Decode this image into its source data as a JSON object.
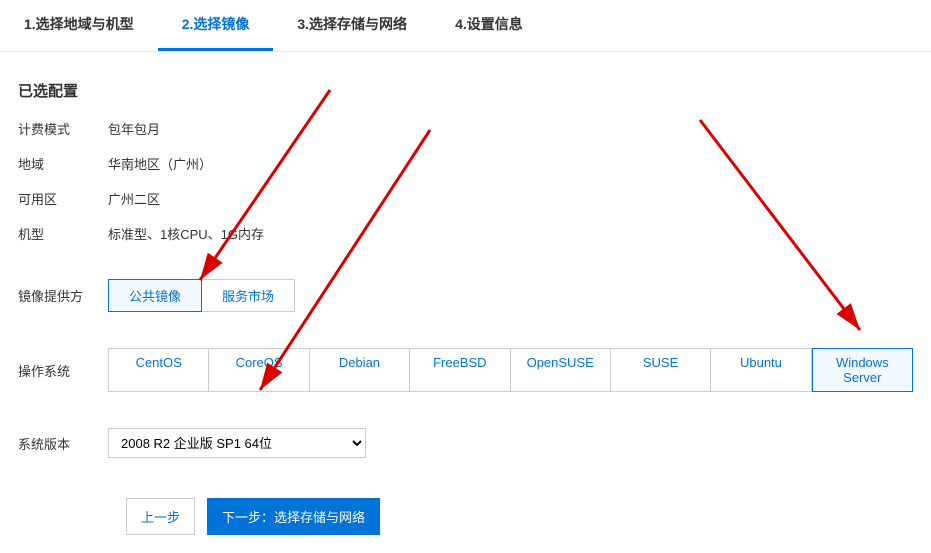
{
  "tabs": {
    "t1": "1.选择地域与机型",
    "t2": "2.选择镜像",
    "t3": "3.选择存储与网络",
    "t4": "4.设置信息"
  },
  "section_title": "已选配置",
  "config": {
    "billing_label": "计费模式",
    "billing_value": "包年包月",
    "region_label": "地域",
    "region_value": "华南地区（广州）",
    "zone_label": "可用区",
    "zone_value": "广州二区",
    "type_label": "机型",
    "type_value": "标准型、1核CPU、1G内存"
  },
  "image_provider": {
    "label": "镜像提供方",
    "public": "公共镜像",
    "market": "服务市场"
  },
  "os": {
    "label": "操作系统",
    "centos": "CentOS",
    "coreos": "CoreOS",
    "debian": "Debian",
    "freebsd": "FreeBSD",
    "opensuse": "OpenSUSE",
    "suse": "SUSE",
    "ubuntu": "Ubuntu",
    "windows": "Windows Server"
  },
  "version": {
    "label": "系统版本",
    "selected": "2008 R2 企业版 SP1 64位"
  },
  "buttons": {
    "prev": "上一步",
    "next": "下一步：选择存储与网络"
  }
}
